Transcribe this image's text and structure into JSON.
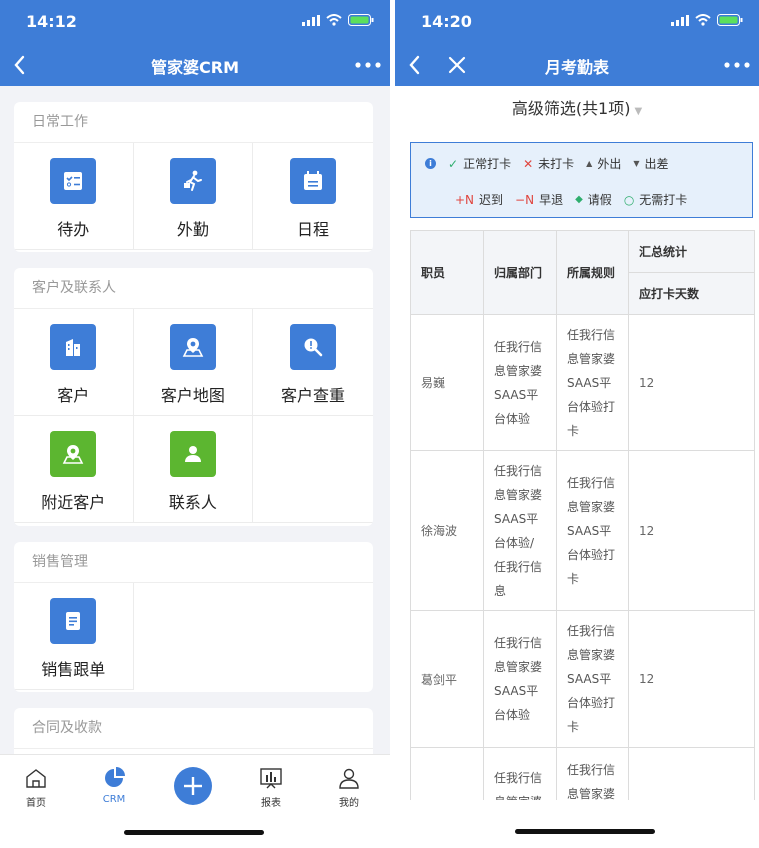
{
  "left": {
    "status_time": "14:12",
    "title": "管家婆CRM",
    "sections": [
      {
        "title": "日常工作",
        "items": [
          {
            "label": "待办",
            "icon": "todo-list-icon",
            "color": "#3e7dd7"
          },
          {
            "label": "外勤",
            "icon": "field-work-icon",
            "color": "#3e7dd7"
          },
          {
            "label": "日程",
            "icon": "calendar-icon",
            "color": "#3e7dd7"
          }
        ]
      },
      {
        "title": "客户及联系人",
        "items": [
          {
            "label": "客户",
            "icon": "building-icon",
            "color": "#3e7dd7"
          },
          {
            "label": "客户地图",
            "icon": "map-pin-icon",
            "color": "#3e7dd7"
          },
          {
            "label": "客户查重",
            "icon": "search-duplicate-icon",
            "color": "#3e7dd7"
          },
          {
            "label": "附近客户",
            "icon": "nearby-map-icon",
            "color": "#5cb630"
          },
          {
            "label": "联系人",
            "icon": "contact-person-icon",
            "color": "#5cb630"
          }
        ]
      },
      {
        "title": "销售管理",
        "items": [
          {
            "label": "销售跟单",
            "icon": "sales-doc-icon",
            "color": "#3e7dd7"
          }
        ]
      },
      {
        "title": "合同及收款",
        "items": []
      }
    ],
    "tabs": [
      {
        "label": "首页",
        "icon": "home-icon",
        "active": false
      },
      {
        "label": "CRM",
        "icon": "pie-chart-icon",
        "active": true
      },
      {
        "label": "",
        "icon": "plus-icon",
        "active": false
      },
      {
        "label": "报表",
        "icon": "report-icon",
        "active": false
      },
      {
        "label": "我的",
        "icon": "user-icon",
        "active": false
      }
    ]
  },
  "right": {
    "status_time": "14:20",
    "title": "月考勤表",
    "filter_label": "高级筛选(共1项)",
    "legend": [
      {
        "symbol": "✓",
        "label": "正常打卡",
        "color": "#2fae6e"
      },
      {
        "symbol": "✕",
        "label": "未打卡",
        "color": "#e0463f"
      },
      {
        "symbol": "▲",
        "label": "外出",
        "color": "#555555"
      },
      {
        "symbol": "▼",
        "label": "出差",
        "color": "#555555"
      },
      {
        "symbol": "+N",
        "label": "迟到",
        "color": "#e0463f"
      },
      {
        "symbol": "−N",
        "label": "早退",
        "color": "#e0463f"
      },
      {
        "symbol": "◆",
        "label": "请假",
        "color": "#2fae6e"
      },
      {
        "symbol": "○",
        "label": "无需打卡",
        "color": "#2fae6e"
      }
    ],
    "table": {
      "headers": {
        "employee": "职员",
        "department": "归属部门",
        "rule": "所属规则",
        "summary": "汇总统计",
        "days": "应打卡天数"
      },
      "rows": [
        {
          "employee": "易巍",
          "department": "任我行信息管家婆SAAS平台体验",
          "rule": "任我行信息管家婆SAAS平台体验打卡",
          "days": "12"
        },
        {
          "employee": "徐海波",
          "department": "任我行信息管家婆SAAS平台体验/任我行信息",
          "rule": "任我行信息管家婆SAAS平台体验打卡",
          "days": "12"
        },
        {
          "employee": "葛剑平",
          "department": "任我行信息管家婆SAAS平台体验",
          "rule": "任我行信息管家婆SAAS平台体验打卡",
          "days": "12"
        },
        {
          "employee": "",
          "department": "任我行信息管家婆",
          "rule": "任我行信息管家婆",
          "days": ""
        }
      ]
    }
  }
}
